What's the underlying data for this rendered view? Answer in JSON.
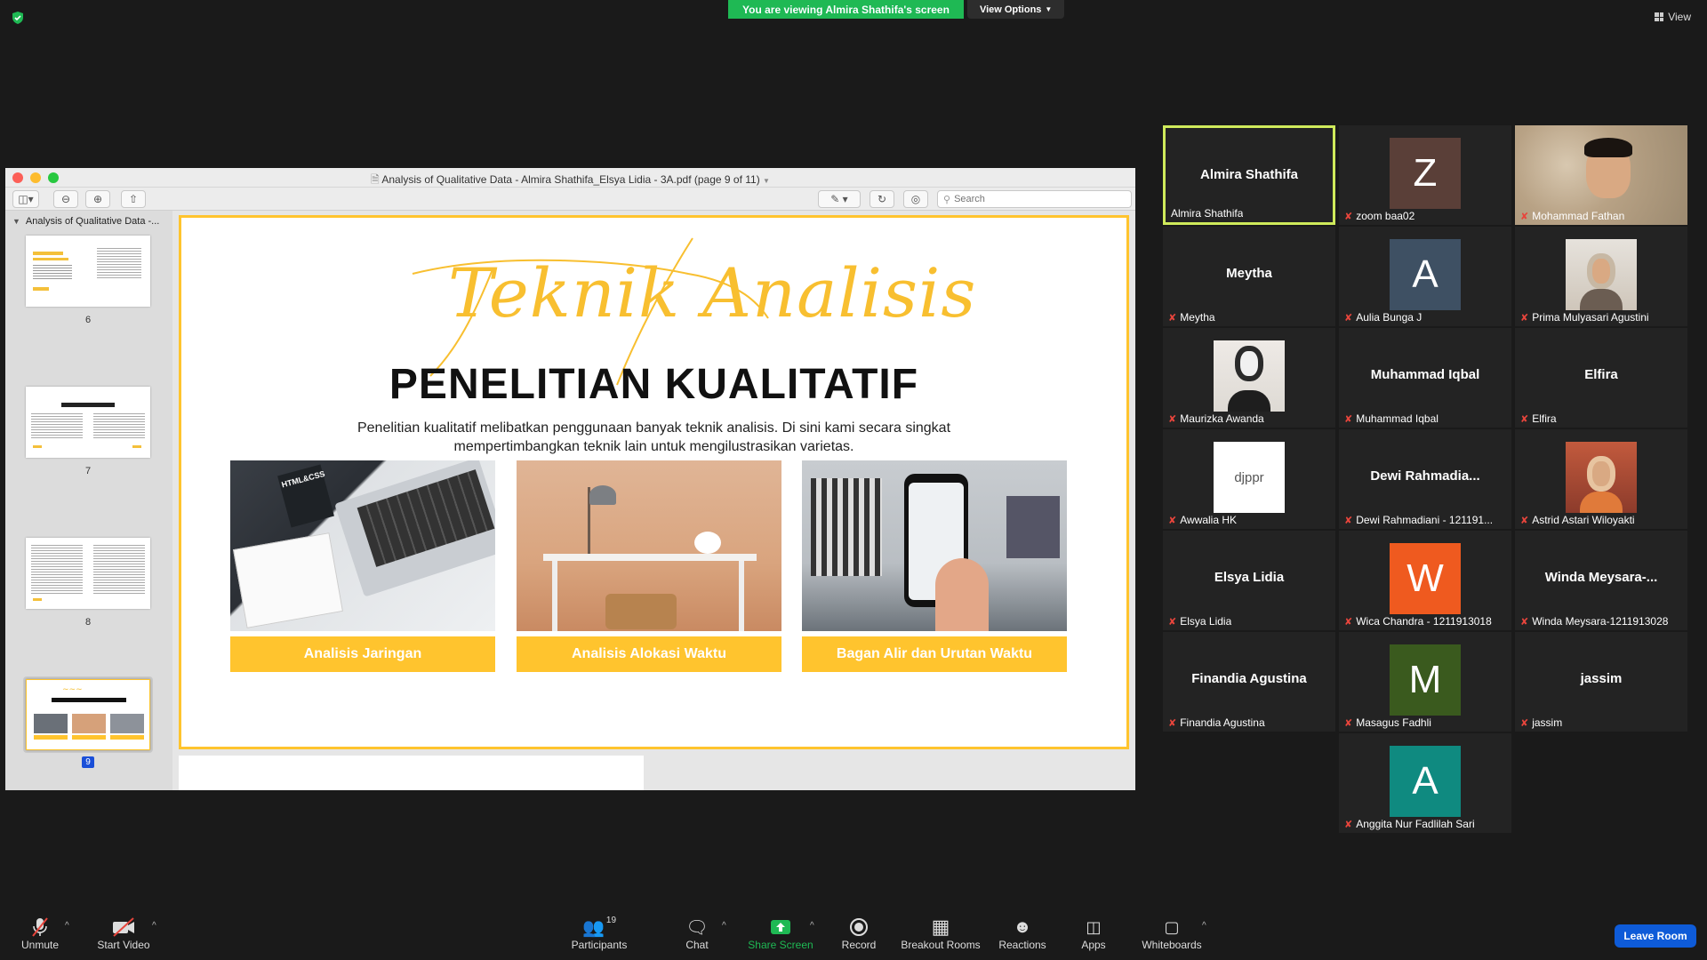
{
  "banner": {
    "viewing_text": "You are viewing Almira Shathifa's screen",
    "view_options": "View Options"
  },
  "view_label": "View",
  "window": {
    "title": "Analysis of Qualitative Data - Almira Shathifa_Elsya Lidia - 3A.pdf (page 9 of 11)",
    "search_placeholder": "Search"
  },
  "sidebar": {
    "title": "Analysis of Qualitative Data -...",
    "pages": [
      "6",
      "7",
      "8",
      "9"
    ]
  },
  "slide": {
    "script_title": "Teknik Analisis",
    "title": "PENELITIAN KUALITATIF",
    "description": "Penelitian kualitatif melibatkan penggunaan banyak teknik analisis. Di sini kami secara singkat mempertimbangkan teknik lain untuk mengilustrasikan varietas.",
    "cards": [
      "Analisis Jaringan",
      "Analisis Alokasi Waktu",
      "Bagan Alir dan Urutan Waktu"
    ],
    "html_css_text": "HTML&CSS"
  },
  "participants": [
    {
      "big": "Almira Shathifa",
      "name": "Almira Shathifa",
      "muted": false
    },
    {
      "initial": "Z",
      "color": "#5a3f38",
      "name": "zoom baa02",
      "muted": true
    },
    {
      "name": "Mohammad Fathan",
      "muted": true
    },
    {
      "big": "Meytha",
      "name": "Meytha",
      "muted": true
    },
    {
      "initial": "A",
      "color": "#3e5063",
      "name": "Aulia Bunga J",
      "muted": true
    },
    {
      "name": "Prima Mulyasari Agustini",
      "muted": true
    },
    {
      "name": "Maurizka Awanda",
      "muted": true
    },
    {
      "big": "Muhammad Iqbal",
      "name": "Muhammad Iqbal",
      "muted": true
    },
    {
      "big": "Elfira",
      "name": "Elfira",
      "muted": true
    },
    {
      "logo": "djppr",
      "name": "Awwalia HK",
      "muted": true
    },
    {
      "big": "Dewi  Rahmadia...",
      "name": "Dewi Rahmadiani - 121191...",
      "muted": true
    },
    {
      "name": "Astrid Astari Wiloyakti",
      "muted": true
    },
    {
      "big": "Elsya Lidia",
      "name": "Elsya Lidia",
      "muted": true
    },
    {
      "initial": "W",
      "color": "#ef5a1f",
      "name": "Wica Chandra - 1211913018",
      "muted": true
    },
    {
      "big": "Winda  Meysara-...",
      "name": "Winda Meysara-1211913028",
      "muted": true
    },
    {
      "big": "Finandia Agustina",
      "name": "Finandia Agustina",
      "muted": true
    },
    {
      "initial": "M",
      "color": "#3a5a1e",
      "name": "Masagus Fadhli",
      "muted": true
    },
    {
      "big": "jassim",
      "name": "jassim",
      "muted": true
    },
    {
      "initial": "A",
      "color": "#0f8a80",
      "name": "Anggita Nur Fadlilah Sari",
      "muted": true
    }
  ],
  "toolbar": {
    "unmute": "Unmute",
    "start_video": "Start Video",
    "participants": "Participants",
    "participants_count": "19",
    "chat": "Chat",
    "share_screen": "Share Screen",
    "record": "Record",
    "breakout_rooms": "Breakout Rooms",
    "reactions": "Reactions",
    "apps": "Apps",
    "whiteboards": "Whiteboards",
    "leave_room": "Leave Room"
  },
  "colors": {
    "accent_yellow": "#ffc42e",
    "share_green": "#1fb954",
    "leave_blue": "#0e5bd8",
    "mute_red": "#e8453c"
  }
}
